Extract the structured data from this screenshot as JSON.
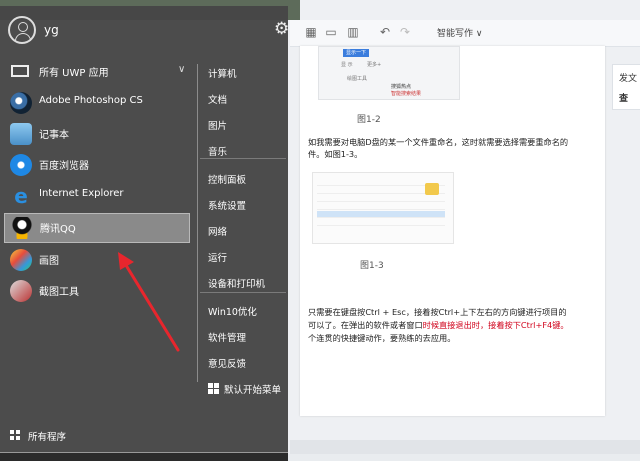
{
  "background_doc": {
    "toolbar": {
      "smart_label": "智能写作 ∨"
    },
    "side_panel": {
      "line1": "发文",
      "line2": "查"
    },
    "figure_caption_1": "图1-2",
    "figure_caption_2": "图1-3",
    "para1_line1": "如我需要对电脑D盘的某一个文件重命名，这时就需要选择需要重命名的",
    "para1_line2": "件。如图1-3。",
    "para2_line1": "只需要在键盘按Ctrl + Esc，接着按Ctrl+上下左右的方向键进行项目的",
    "para2_line2_a": "可以了。在弹出的软件或者窗口",
    "para2_line2_b": "时候直接退出时，接着按下Ctrl+F4键。",
    "para2_line3": "个连贯的快捷键动作，要熟练的去应用。",
    "shot1": {
      "button": "显示一下",
      "sub1": "显 示",
      "sub2": "更多+",
      "tab": "绘图工具",
      "note1": "搜狐热点",
      "note2": "智能搜索结果"
    }
  },
  "start_menu": {
    "user": {
      "name": "yg"
    },
    "apps": [
      {
        "label": "所有 UWP 应用",
        "icon": "uwp-window-icon"
      },
      {
        "label": "Adobe Photoshop CS",
        "icon": "photoshop-icon"
      },
      {
        "label": "记事本",
        "icon": "notepad-icon"
      },
      {
        "label": "百度浏览器",
        "icon": "baidu-browser-icon"
      },
      {
        "label": "Internet Explorer",
        "icon": "internet-explorer-icon"
      },
      {
        "label": "腾讯QQ",
        "icon": "qq-penguin-icon"
      },
      {
        "label": "画图",
        "icon": "paint-icon"
      },
      {
        "label": "截图工具",
        "icon": "snipping-tool-icon"
      }
    ],
    "selected_index": 5,
    "all_programs": "所有程序",
    "system_items": [
      "计算机",
      "文档",
      "图片",
      "音乐",
      "控制面板",
      "系统设置",
      "网络",
      "运行",
      "设备和打印机",
      "Win10优化",
      "软件管理",
      "意见反馈"
    ],
    "default_start_menu": "默认开始菜单"
  },
  "colors": {
    "menu_bg": "#464646",
    "selected_bg": "#8a8a8a",
    "annotation_red": "#e8262d"
  }
}
